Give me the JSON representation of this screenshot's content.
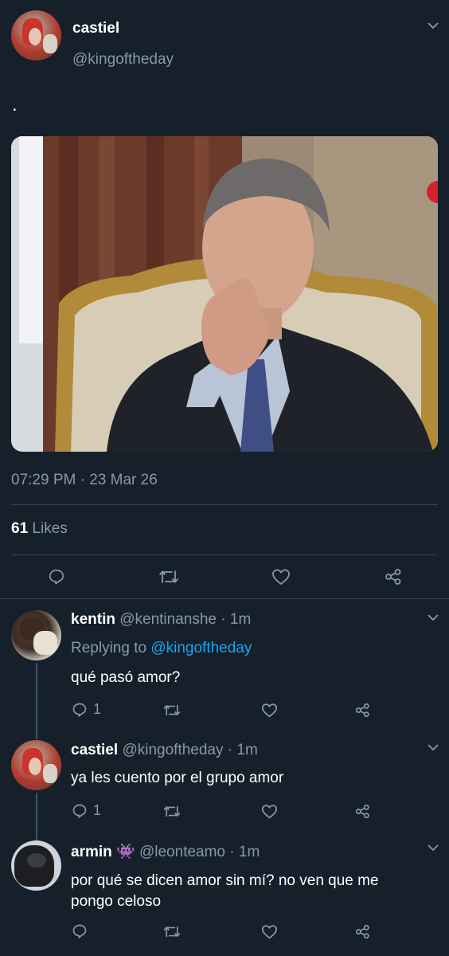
{
  "main_tweet": {
    "display_name": "castiel",
    "handle": "@kingoftheday",
    "text": ".",
    "timestamp": "07:29 PM · 23 Mar 26",
    "likes_count": "61",
    "likes_label": "Likes"
  },
  "replies": [
    {
      "display_name": "kentin",
      "handle": "@kentinanshe",
      "time": "· 1m",
      "replying_label": "Replying to",
      "replying_handle": "@kingoftheday",
      "text": "qué pasó amor?",
      "reply_count": "1"
    },
    {
      "display_name": "castiel",
      "handle": "@kingoftheday",
      "time": "· 1m",
      "text": "ya les cuento por el grupo amor",
      "reply_count": "1"
    },
    {
      "display_name": "armin",
      "name_emoji": "👾",
      "handle": "@leonteamo",
      "time": "· 1m",
      "text_line1": "por qué se dicen amor sin mí? no ven que me",
      "text_line2": "pongo celoso"
    }
  ],
  "colors": {
    "background": "#15202b",
    "muted": "#8899a6",
    "link": "#1da1f2",
    "divider": "#38444d"
  }
}
